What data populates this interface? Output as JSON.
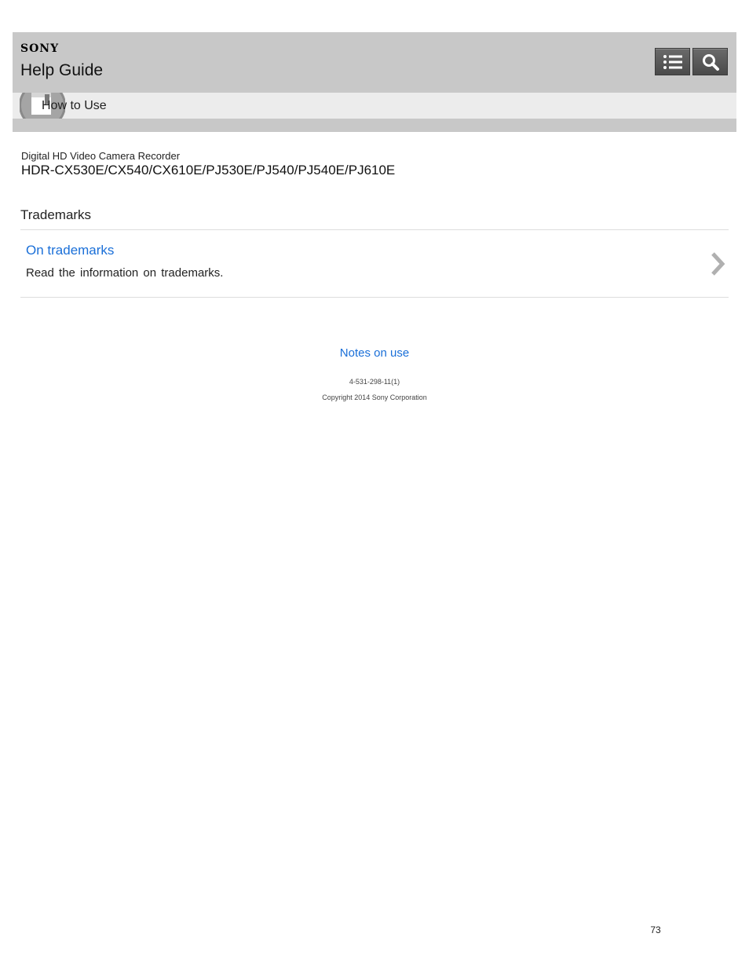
{
  "header": {
    "brand": "SONY",
    "title": "Help Guide",
    "breadcrumb": "How to Use",
    "toc_icon": "list-icon",
    "search_icon": "search-icon",
    "crumb_icon": "book-icon",
    "background_color": "#c8c8c8",
    "breadcrumb_band_color": "#ececec"
  },
  "product": {
    "type": "Digital HD Video Camera Recorder",
    "model": "HDR-CX530E/CX540/CX610E/PJ530E/PJ540/PJ540E/PJ610E"
  },
  "section": {
    "title": "Trademarks",
    "topics": [
      {
        "link": "On trademarks",
        "description": "Read the information on trademarks.",
        "icon": "chevron-right-icon"
      }
    ]
  },
  "footer": {
    "link": "Notes on use",
    "doc_code": "4-531-298-11(1)",
    "copyright": "Copyright 2014 Sony Corporation",
    "page_number": "73"
  },
  "colors": {
    "link": "#1a6fd8",
    "button": "#555555"
  }
}
